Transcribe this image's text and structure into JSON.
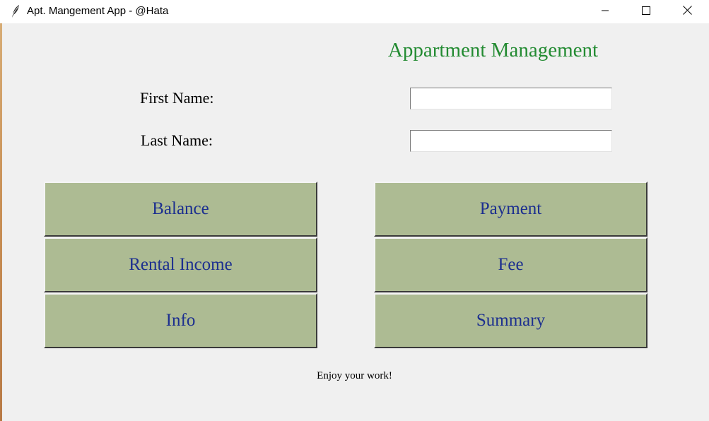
{
  "window": {
    "title": "Apt. Mangement App - @Hata",
    "icon": "feather-icon",
    "controls": [
      "minimize-icon",
      "maximize-icon",
      "close-icon"
    ]
  },
  "heading": "Appartment Management",
  "form": {
    "first_name_label": "First Name:",
    "first_name_value": "",
    "last_name_label": "Last Name:",
    "last_name_value": ""
  },
  "buttons": {
    "balance": "Balance",
    "payment": "Payment",
    "rental_income": "Rental Income",
    "fee": "Fee",
    "info": "Info",
    "summary": "Summary"
  },
  "footer": "Enjoy your work!",
  "colors": {
    "background": "#f0f0f0",
    "heading": "#238b32",
    "button_bg": "#adbb93",
    "button_text": "#1c2f8f"
  }
}
